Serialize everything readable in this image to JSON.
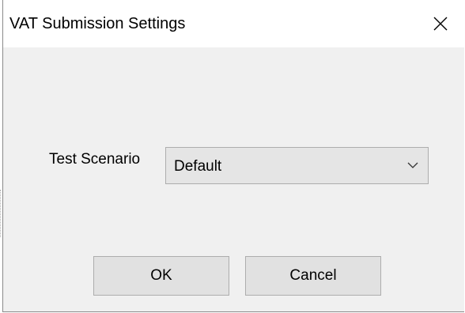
{
  "window": {
    "title": "VAT Submission Settings"
  },
  "icons": {
    "close": "close-icon",
    "dropdown": "chevron-down-icon"
  },
  "form": {
    "test_scenario_label": "Test Scenario",
    "test_scenario_value": "Default"
  },
  "buttons": {
    "ok_label": "OK",
    "cancel_label": "Cancel"
  },
  "colors": {
    "dialog_bg": "#f0f0f0",
    "titlebar_bg": "#ffffff",
    "button_bg": "#e1e1e1",
    "button_border": "#adadad"
  }
}
